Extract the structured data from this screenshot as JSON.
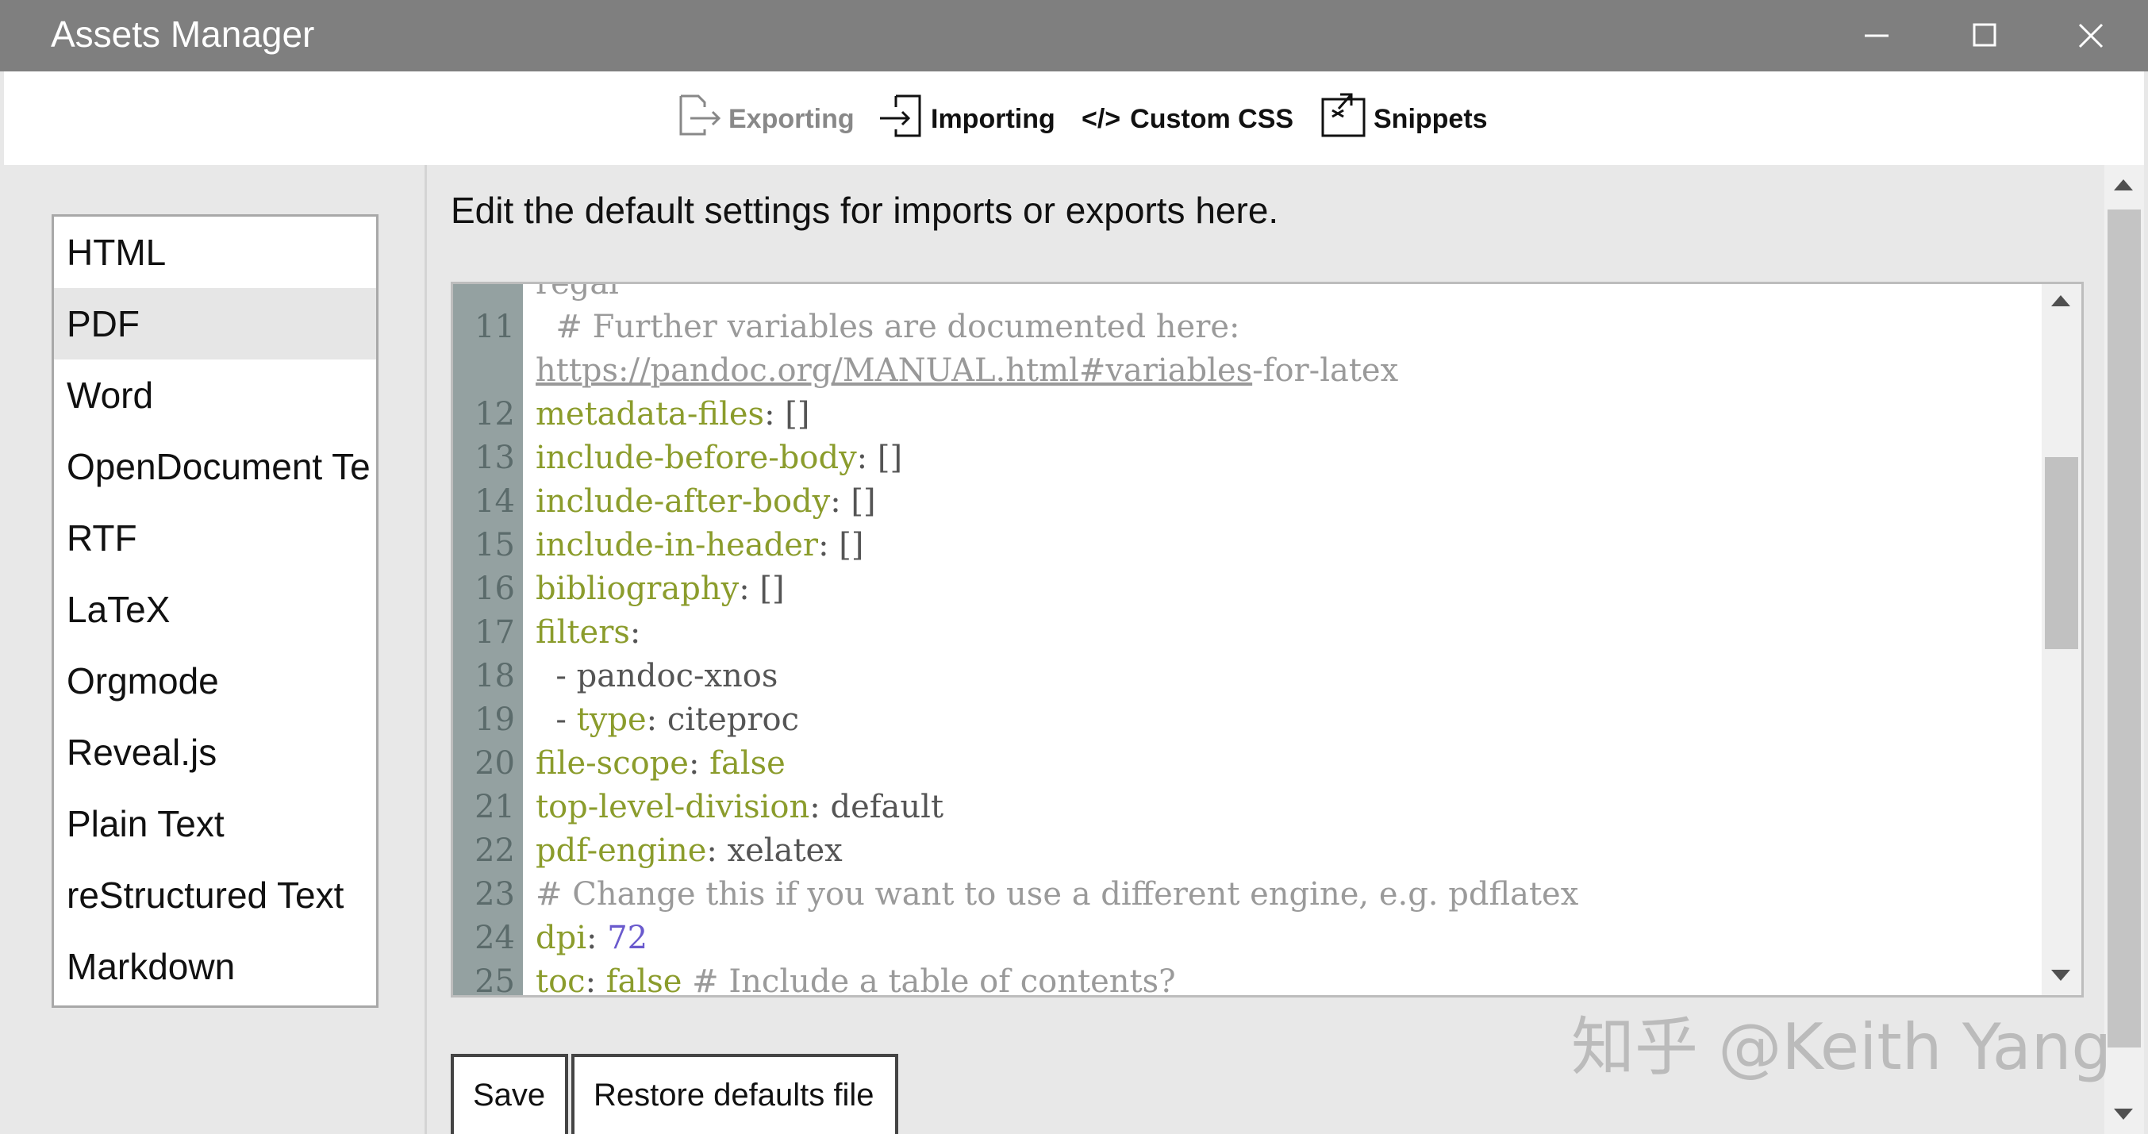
{
  "window": {
    "title": "Assets Manager",
    "controls": [
      "minimize",
      "maximize",
      "close"
    ]
  },
  "toolbar": {
    "tabs": [
      {
        "label": "Exporting",
        "icon": "export-icon",
        "active": true
      },
      {
        "label": "Importing",
        "icon": "import-icon",
        "active": false
      },
      {
        "label": "Custom CSS",
        "icon": "code-icon",
        "prefix": "</>",
        "active": false
      },
      {
        "label": "Snippets",
        "icon": "snippets-icon",
        "active": false
      }
    ]
  },
  "formats": {
    "selected": "PDF",
    "items": [
      "HTML",
      "PDF",
      "Word",
      "OpenDocument Te",
      "RTF",
      "LaTeX",
      "Orgmode",
      "Reveal.js",
      "Plain Text",
      "reStructured Text",
      "Markdown"
    ]
  },
  "main": {
    "intro": "Edit the default settings for imports or exports here."
  },
  "editor": {
    "lines": [
      {
        "num": "",
        "parts": [
          {
            "t": "regal",
            "c": "c"
          }
        ]
      },
      {
        "num": "11",
        "parts": [
          {
            "t": "  # Further variables are documented here:",
            "c": "c"
          }
        ]
      },
      {
        "num": "",
        "parts": [
          {
            "t": "https://pandoc.org/MANUAL.html#variables",
            "c": "u"
          },
          {
            "t": "-for-latex",
            "c": "c"
          }
        ]
      },
      {
        "num": "12",
        "parts": [
          {
            "t": "metadata-files",
            "c": "k"
          },
          {
            "t": ": []",
            "c": "p"
          }
        ]
      },
      {
        "num": "13",
        "parts": [
          {
            "t": "include-before-body",
            "c": "k"
          },
          {
            "t": ": []",
            "c": "p"
          }
        ]
      },
      {
        "num": "14",
        "parts": [
          {
            "t": "include-after-body",
            "c": "k"
          },
          {
            "t": ": []",
            "c": "p"
          }
        ]
      },
      {
        "num": "15",
        "parts": [
          {
            "t": "include-in-header",
            "c": "k"
          },
          {
            "t": ": []",
            "c": "p"
          }
        ]
      },
      {
        "num": "16",
        "parts": [
          {
            "t": "bibliography",
            "c": "k"
          },
          {
            "t": ": []",
            "c": "p"
          }
        ]
      },
      {
        "num": "17",
        "parts": [
          {
            "t": "filters",
            "c": "k"
          },
          {
            "t": ":",
            "c": "p"
          }
        ]
      },
      {
        "num": "18",
        "parts": [
          {
            "t": "  - pandoc-xnos",
            "c": "v"
          }
        ]
      },
      {
        "num": "19",
        "parts": [
          {
            "t": "  - ",
            "c": "v"
          },
          {
            "t": "type",
            "c": "k"
          },
          {
            "t": ": citeproc",
            "c": "v"
          }
        ]
      },
      {
        "num": "20",
        "parts": [
          {
            "t": "file-scope",
            "c": "k"
          },
          {
            "t": ": ",
            "c": "p"
          },
          {
            "t": "false",
            "c": "k"
          }
        ]
      },
      {
        "num": "21",
        "parts": [
          {
            "t": "top-level-division",
            "c": "k"
          },
          {
            "t": ": default",
            "c": "v"
          }
        ]
      },
      {
        "num": "22",
        "parts": [
          {
            "t": "pdf-engine",
            "c": "k"
          },
          {
            "t": ": xelatex",
            "c": "v"
          }
        ]
      },
      {
        "num": "23",
        "parts": [
          {
            "t": "# Change this if you want to use a different engine, e.g. pdflatex",
            "c": "c"
          }
        ]
      },
      {
        "num": "24",
        "parts": [
          {
            "t": "dpi",
            "c": "k"
          },
          {
            "t": ": ",
            "c": "p"
          },
          {
            "t": "72",
            "c": "n"
          }
        ]
      },
      {
        "num": "25",
        "parts": [
          {
            "t": "toc",
            "c": "k"
          },
          {
            "t": ": ",
            "c": "p"
          },
          {
            "t": "false",
            "c": "k"
          },
          {
            "t": " # Include a table of contents?",
            "c": "c"
          }
        ]
      }
    ]
  },
  "buttons": {
    "save": "Save",
    "restore": "Restore defaults file"
  },
  "watermark": "知乎 @Keith Yang",
  "colors": {
    "titlebar": "#7f7f7f",
    "gutter": "#94a1a1",
    "key": "#8b9c2c",
    "comment": "#9a9a9a",
    "number": "#6a5acd"
  }
}
